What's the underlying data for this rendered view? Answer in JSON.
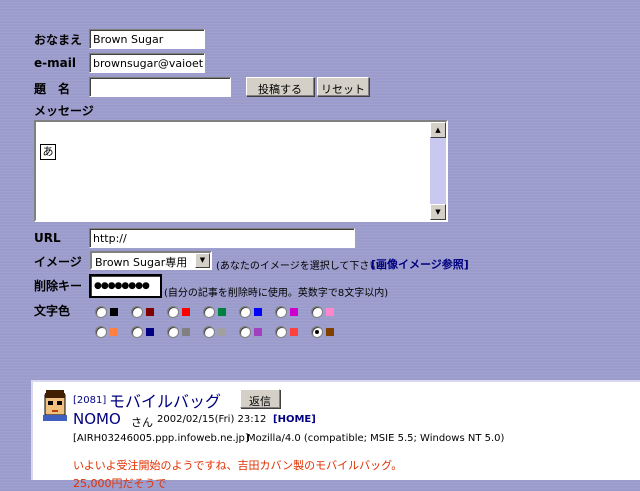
{
  "form": {
    "name_label": "おなまえ",
    "name_value": "Brown Sugar",
    "email_label": "e-mail",
    "email_value": "brownsugar@vaioeth",
    "subject_label": "題　名",
    "subject_value": "",
    "submit_label": "投稿する",
    "reset_label": "リセット",
    "message_label": "メッセージ",
    "ime_indicator": "あ",
    "scroll_up": "▲",
    "scroll_down": "▼",
    "url_label": "URL",
    "url_value": "http://",
    "image_label": "イメージ",
    "image_selected": "Brown Sugar専用",
    "image_arrow": "▼",
    "image_hint": "(あなたのイメージを選択して下さい)",
    "image_ref_link": "[画像イメージ参照]",
    "delete_key_label": "削除キー",
    "delete_key_value": "●●●●●●●●",
    "delete_key_hint": "(自分の記事を削除時に使用。英数字で8文字以内)",
    "text_color_label": "文字色",
    "colors_row1": [
      "#000000",
      "#800000",
      "#ff0000",
      "#008040",
      "#0000ff",
      "#cc00cc",
      "#ff88cc"
    ],
    "colors_row2": [
      "#ff8040",
      "#000080",
      "#808080",
      "#a0a0a0",
      "#a040c0",
      "#ff4040",
      "#804000"
    ],
    "selected_color_index": 13
  },
  "post": {
    "number": "[2081]",
    "title": "モバイルバッグ",
    "reply_label": "返信",
    "author": "NOMO",
    "san": "さん",
    "date": "2002/02/15(Fri) 23:12",
    "home": "[HOME]",
    "host": "[AIRH03246005.ppp.infoweb.ne.jp]",
    "agent": "Mozilla/4.0 (compatible; MSIE 5.5; Windows NT 5.0)",
    "body_line1": "いよいよ受注開始のようですね、吉田カバン製のモバイルバッグ。",
    "body_line2": "25,000円だそうで",
    "body_color": "#e03000"
  }
}
